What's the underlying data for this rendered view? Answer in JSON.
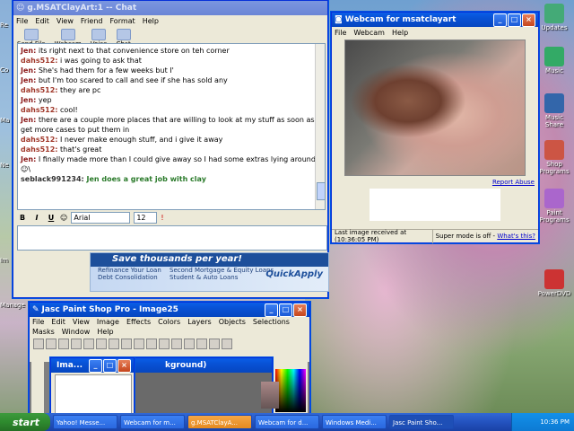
{
  "chat": {
    "title": "g.MSATClayArt:1 -- Chat",
    "menu": [
      "File",
      "Edit",
      "View",
      "Friend",
      "Format",
      "Help"
    ],
    "toolbar": [
      "Send File",
      "Webcam",
      "Voice",
      "Chat"
    ],
    "messages": [
      {
        "who": "Jen:",
        "text": " its right next to that convenience store on teh corner"
      },
      {
        "who": "dahs512:",
        "text": " i was going to ask that"
      },
      {
        "who": "Jen:",
        "text": " She's had them for a few weeks but I'"
      },
      {
        "who": "Jen:",
        "text": " but I'm too scared to call and see if she has sold any"
      },
      {
        "who": "dahs512:",
        "text": " they are pc"
      },
      {
        "who": "Jen:",
        "text": " yep"
      },
      {
        "who": "dahs512:",
        "text": " cool!"
      },
      {
        "who": "Jen:",
        "text": " there are a couple more places that are willing to look at my stuff as soon as I get more cases to put them in"
      },
      {
        "who": "dahs512:",
        "text": " I never make enough stuff, and i give it away"
      },
      {
        "who": "dahs512:",
        "text": " that's great"
      },
      {
        "who": "Jen:",
        "text": " I finally made more than I could give away so I had some extras lying around ☺\\"
      }
    ],
    "last_message": {
      "who": "seblack991234:",
      "text": " Jen does a great job with clay"
    },
    "font": "Arial",
    "font_size": "12",
    "ad": {
      "headline": "Save thousands per year!",
      "items": [
        "Refinance Your Loan",
        "Second Mortgage & Equity Loans",
        "Debt Consolidation",
        "Student & Auto Loans"
      ],
      "brand": "QuickApply"
    }
  },
  "webcam": {
    "title": "Webcam for msatclayart",
    "menu": [
      "File",
      "Webcam",
      "Help"
    ],
    "report_link": "Report Abuse",
    "status_left": "Last image received at (10:36:05 PM)",
    "status_right": "Super mode is off - ",
    "whats_this": "What's this?"
  },
  "psp": {
    "title": "Jasc Paint Shop Pro - Image25",
    "menu": [
      "File",
      "Edit",
      "View",
      "Image",
      "Effects",
      "Colors",
      "Layers",
      "Objects",
      "Selections",
      "Masks",
      "Window",
      "Help"
    ],
    "child1": "Ima...",
    "child2": "kground)"
  },
  "desktop": {
    "icons": [
      "Updates",
      "Music",
      "Music Share",
      "Shop Programs",
      "Paint Programs",
      "PowerDVD"
    ],
    "left_icons": [
      "Re",
      "Co",
      "Ma",
      "Ne",
      "Im",
      "Manage"
    ]
  },
  "taskbar": {
    "start": "start",
    "tasks": [
      "Yahoo! Messe...",
      "Webcam for m...",
      "g.MSATClayA...",
      "Webcam for d...",
      "Windows Medi...",
      "Jasc Paint Sho..."
    ],
    "clock": "10:36 PM"
  }
}
